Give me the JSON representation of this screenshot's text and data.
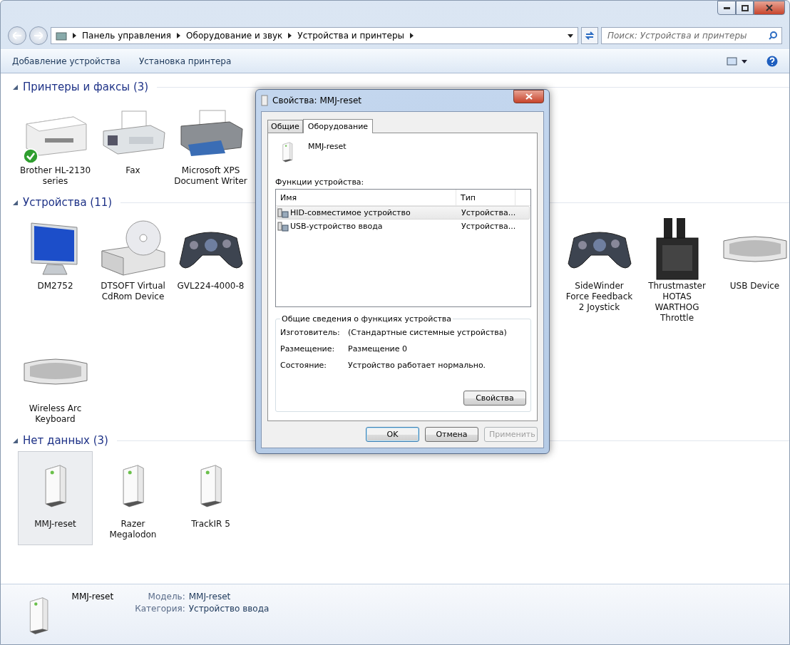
{
  "breadcrumb": [
    "Панель управления",
    "Оборудование и звук",
    "Устройства и принтеры"
  ],
  "search": {
    "placeholder": "Поиск: Устройства и принтеры"
  },
  "toolbar": [
    "Добавление устройства",
    "Установка принтера"
  ],
  "groups": [
    {
      "title": "Принтеры и факсы (3)",
      "expanded": true,
      "items": [
        {
          "kind": "laser-printer",
          "label": "Brother HL-2130 series",
          "default": true,
          "selected": false
        },
        {
          "kind": "fax",
          "label": "Fax",
          "default": false,
          "selected": false
        },
        {
          "kind": "printer",
          "label": "Microsoft XPS Document Writer",
          "default": false,
          "selected": false
        }
      ]
    },
    {
      "title": "Устройства (11)",
      "expanded": true,
      "items": [
        {
          "kind": "monitor",
          "label": "DM2752",
          "default": false,
          "selected": false
        },
        {
          "kind": "cd-drive",
          "label": "DTSOFT Virtual CdRom Device",
          "default": false,
          "selected": false
        },
        {
          "kind": "gamepad",
          "label": "GVL224-4000-8",
          "default": false,
          "selected": false
        },
        {
          "kind": "gamepad",
          "label": "SideWinder Force Feedback 2 Joystick",
          "default": false,
          "selected": false
        },
        {
          "kind": "throttle",
          "label": "Thrustmaster HOTAS WARTHOG Throttle",
          "default": false,
          "selected": false
        },
        {
          "kind": "keyboard",
          "label": "USB Device",
          "default": false,
          "selected": false
        },
        {
          "kind": "keyboard",
          "label": "Wireless Arc Keyboard",
          "default": false,
          "selected": false
        }
      ]
    },
    {
      "title": "Нет данных (3)",
      "expanded": true,
      "items": [
        {
          "kind": "tower",
          "label": "MMJ-reset",
          "default": false,
          "selected": true
        },
        {
          "kind": "tower",
          "label": "Razer Megalodon",
          "default": false,
          "selected": false
        },
        {
          "kind": "tower",
          "label": "TrackIR 5",
          "default": false,
          "selected": false
        }
      ]
    }
  ],
  "details": {
    "name": "MMJ-reset",
    "fields": [
      {
        "label": "Модель:",
        "value": "MMJ-reset"
      },
      {
        "label": "Категория:",
        "value": "Устройство ввода"
      }
    ]
  },
  "dialog": {
    "title": "Свойства: MMJ-reset",
    "tabs": [
      {
        "label": "Общие",
        "selected": false
      },
      {
        "label": "Оборудование",
        "selected": true
      }
    ],
    "device_name": "MMJ-reset",
    "functions_label": "Функции устройства:",
    "columns": [
      "Имя",
      "Тип"
    ],
    "rows": [
      {
        "name": "HID-совместимое устройство",
        "type": "Устройства...",
        "selected": true
      },
      {
        "name": "USB-устройство ввода",
        "type": "Устройства...",
        "selected": false
      }
    ],
    "summary_title": "Общие сведения о функциях устройства",
    "summary": [
      {
        "label": "Изготовитель:",
        "value": "(Стандартные системные устройства)"
      },
      {
        "label": "Размещение:",
        "value": "Размещение 0"
      },
      {
        "label": "Состояние:",
        "value": "Устройство работает нормально."
      }
    ],
    "properties_button": "Свойства",
    "buttons": [
      {
        "label": "OK",
        "disabled": false,
        "default": true
      },
      {
        "label": "Отмена",
        "disabled": false,
        "default": false
      },
      {
        "label": "Применить",
        "disabled": true,
        "default": false
      }
    ]
  }
}
